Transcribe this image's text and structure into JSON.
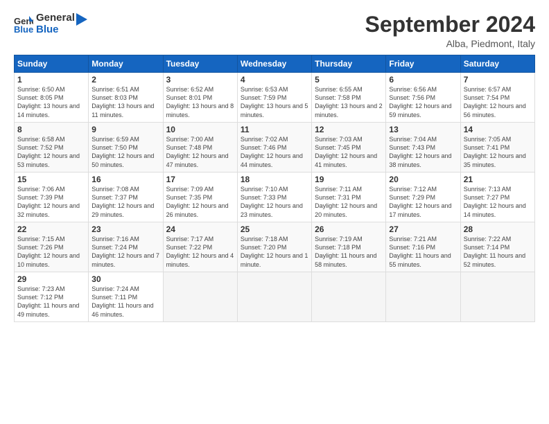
{
  "header": {
    "logo_line1": "General",
    "logo_line2": "Blue",
    "month": "September 2024",
    "location": "Alba, Piedmont, Italy"
  },
  "weekdays": [
    "Sunday",
    "Monday",
    "Tuesday",
    "Wednesday",
    "Thursday",
    "Friday",
    "Saturday"
  ],
  "weeks": [
    [
      {
        "day": "1",
        "sunrise": "6:50 AM",
        "sunset": "8:05 PM",
        "daylight": "13 hours and 14 minutes."
      },
      {
        "day": "2",
        "sunrise": "6:51 AM",
        "sunset": "8:03 PM",
        "daylight": "13 hours and 11 minutes."
      },
      {
        "day": "3",
        "sunrise": "6:52 AM",
        "sunset": "8:01 PM",
        "daylight": "13 hours and 8 minutes."
      },
      {
        "day": "4",
        "sunrise": "6:53 AM",
        "sunset": "7:59 PM",
        "daylight": "13 hours and 5 minutes."
      },
      {
        "day": "5",
        "sunrise": "6:55 AM",
        "sunset": "7:58 PM",
        "daylight": "13 hours and 2 minutes."
      },
      {
        "day": "6",
        "sunrise": "6:56 AM",
        "sunset": "7:56 PM",
        "daylight": "12 hours and 59 minutes."
      },
      {
        "day": "7",
        "sunrise": "6:57 AM",
        "sunset": "7:54 PM",
        "daylight": "12 hours and 56 minutes."
      }
    ],
    [
      {
        "day": "8",
        "sunrise": "6:58 AM",
        "sunset": "7:52 PM",
        "daylight": "12 hours and 53 minutes."
      },
      {
        "day": "9",
        "sunrise": "6:59 AM",
        "sunset": "7:50 PM",
        "daylight": "12 hours and 50 minutes."
      },
      {
        "day": "10",
        "sunrise": "7:00 AM",
        "sunset": "7:48 PM",
        "daylight": "12 hours and 47 minutes."
      },
      {
        "day": "11",
        "sunrise": "7:02 AM",
        "sunset": "7:46 PM",
        "daylight": "12 hours and 44 minutes."
      },
      {
        "day": "12",
        "sunrise": "7:03 AM",
        "sunset": "7:45 PM",
        "daylight": "12 hours and 41 minutes."
      },
      {
        "day": "13",
        "sunrise": "7:04 AM",
        "sunset": "7:43 PM",
        "daylight": "12 hours and 38 minutes."
      },
      {
        "day": "14",
        "sunrise": "7:05 AM",
        "sunset": "7:41 PM",
        "daylight": "12 hours and 35 minutes."
      }
    ],
    [
      {
        "day": "15",
        "sunrise": "7:06 AM",
        "sunset": "7:39 PM",
        "daylight": "12 hours and 32 minutes."
      },
      {
        "day": "16",
        "sunrise": "7:08 AM",
        "sunset": "7:37 PM",
        "daylight": "12 hours and 29 minutes."
      },
      {
        "day": "17",
        "sunrise": "7:09 AM",
        "sunset": "7:35 PM",
        "daylight": "12 hours and 26 minutes."
      },
      {
        "day": "18",
        "sunrise": "7:10 AM",
        "sunset": "7:33 PM",
        "daylight": "12 hours and 23 minutes."
      },
      {
        "day": "19",
        "sunrise": "7:11 AM",
        "sunset": "7:31 PM",
        "daylight": "12 hours and 20 minutes."
      },
      {
        "day": "20",
        "sunrise": "7:12 AM",
        "sunset": "7:29 PM",
        "daylight": "12 hours and 17 minutes."
      },
      {
        "day": "21",
        "sunrise": "7:13 AM",
        "sunset": "7:27 PM",
        "daylight": "12 hours and 14 minutes."
      }
    ],
    [
      {
        "day": "22",
        "sunrise": "7:15 AM",
        "sunset": "7:26 PM",
        "daylight": "12 hours and 10 minutes."
      },
      {
        "day": "23",
        "sunrise": "7:16 AM",
        "sunset": "7:24 PM",
        "daylight": "12 hours and 7 minutes."
      },
      {
        "day": "24",
        "sunrise": "7:17 AM",
        "sunset": "7:22 PM",
        "daylight": "12 hours and 4 minutes."
      },
      {
        "day": "25",
        "sunrise": "7:18 AM",
        "sunset": "7:20 PM",
        "daylight": "12 hours and 1 minute."
      },
      {
        "day": "26",
        "sunrise": "7:19 AM",
        "sunset": "7:18 PM",
        "daylight": "11 hours and 58 minutes."
      },
      {
        "day": "27",
        "sunrise": "7:21 AM",
        "sunset": "7:16 PM",
        "daylight": "11 hours and 55 minutes."
      },
      {
        "day": "28",
        "sunrise": "7:22 AM",
        "sunset": "7:14 PM",
        "daylight": "11 hours and 52 minutes."
      }
    ],
    [
      {
        "day": "29",
        "sunrise": "7:23 AM",
        "sunset": "7:12 PM",
        "daylight": "11 hours and 49 minutes."
      },
      {
        "day": "30",
        "sunrise": "7:24 AM",
        "sunset": "7:11 PM",
        "daylight": "11 hours and 46 minutes."
      },
      null,
      null,
      null,
      null,
      null
    ]
  ]
}
